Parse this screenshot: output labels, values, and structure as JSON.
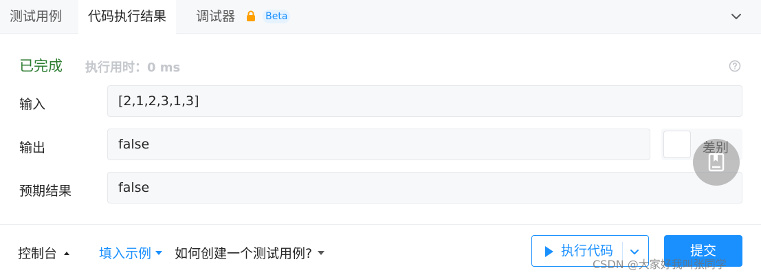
{
  "tabs": [
    {
      "label": "测试用例",
      "active": false
    },
    {
      "label": "代码执行结果",
      "active": true
    },
    {
      "label": "调试器",
      "active": false,
      "badge": "Beta",
      "icon": "lock-icon"
    }
  ],
  "result": {
    "status": "已完成",
    "runtime": "执行用时：0 ms"
  },
  "rows": {
    "input_label": "输入",
    "input_value": "[2,1,2,3,1,3]",
    "output_label": "输出",
    "output_value": "false",
    "expected_label": "预期结果",
    "expected_value": "false"
  },
  "diff": {
    "label": "差别",
    "checked": false
  },
  "bottom": {
    "console": "控制台",
    "fill_example": "填入示例",
    "howto": "如何创建一个测试用例?",
    "run": "执行代码",
    "submit": "提交"
  },
  "watermark": "CSDN @大家好我叫张同学",
  "colors": {
    "accent": "#1a90ff",
    "success": "#2e7d32",
    "lock": "#ff9f00"
  }
}
